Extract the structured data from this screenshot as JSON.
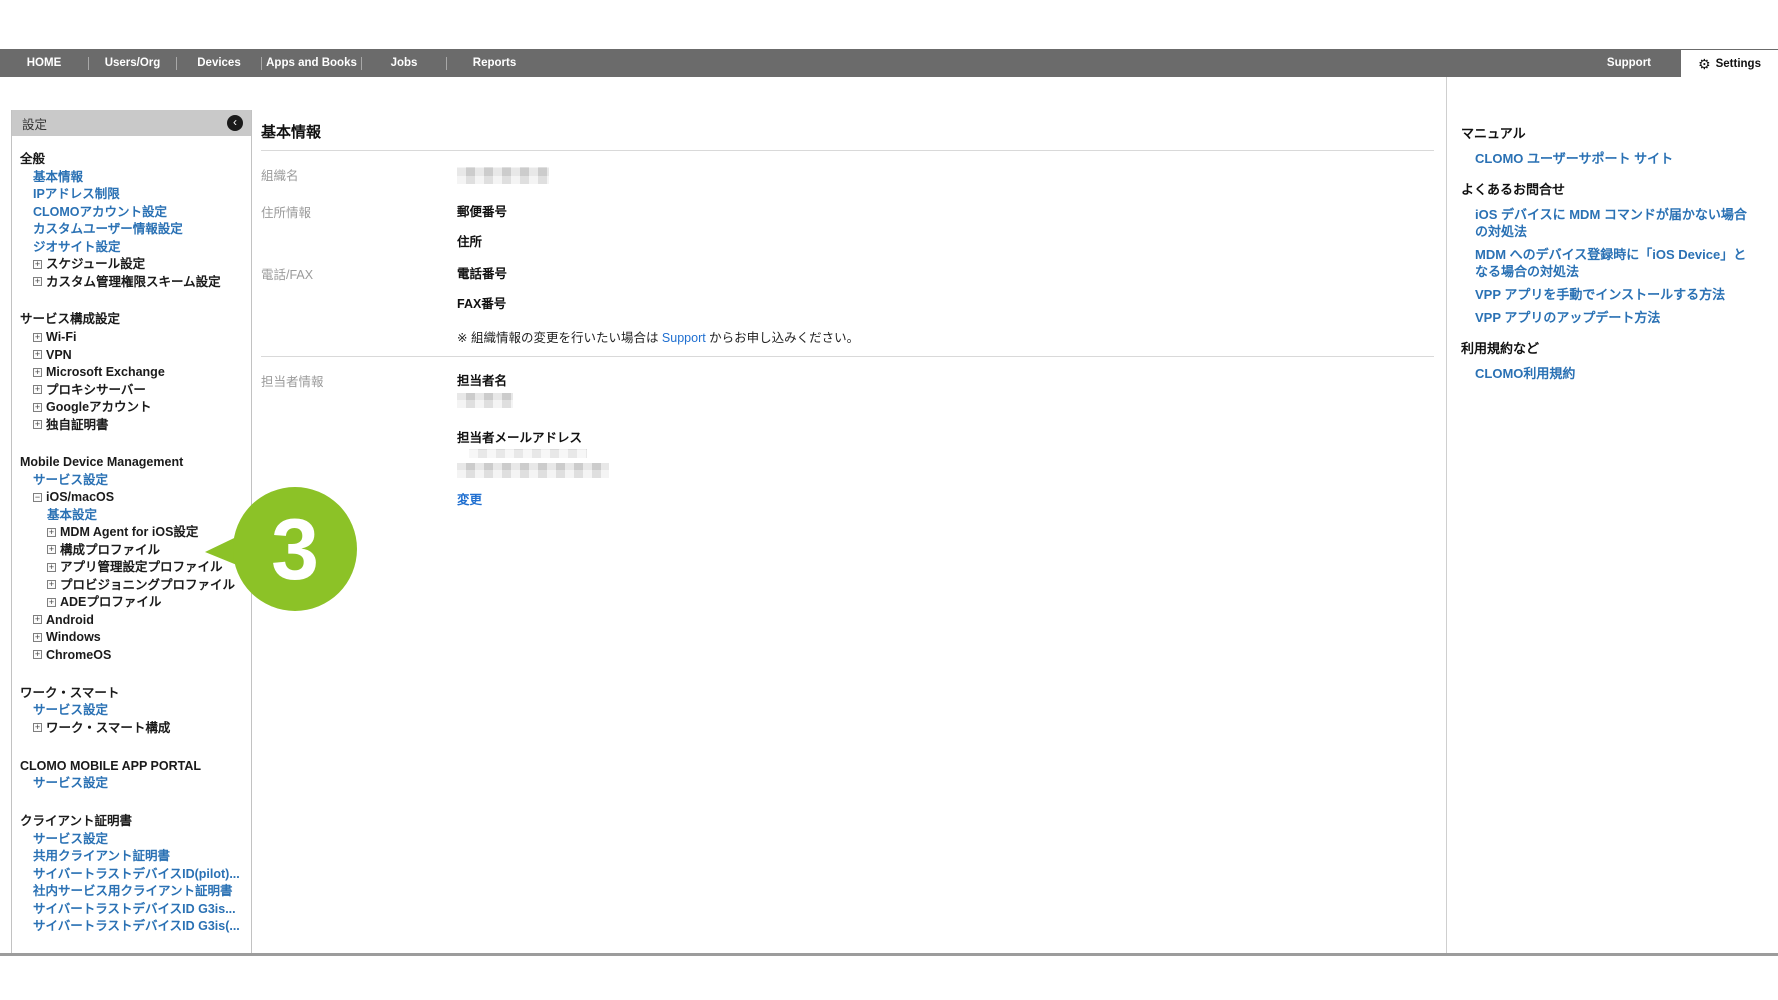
{
  "nav": {
    "items": [
      "HOME",
      "Users/Org",
      "Devices",
      "Apps and Books",
      "Jobs",
      "Reports"
    ],
    "support_label": "Support",
    "settings_label": "Settings",
    "settings_icon": "gear-icon"
  },
  "sidebar": {
    "header": "設定",
    "collapse_icon": "chevron-left-circle-icon",
    "sections": [
      {
        "title": "全般",
        "items": [
          {
            "label": "基本情報",
            "type": "link",
            "indent": 0
          },
          {
            "label": "IPアドレス制限",
            "type": "link",
            "indent": 0
          },
          {
            "label": "CLOMOアカウント設定",
            "type": "link",
            "indent": 0
          },
          {
            "label": "カスタムユーザー情報設定",
            "type": "link",
            "indent": 0
          },
          {
            "label": "ジオサイト設定",
            "type": "link",
            "indent": 0
          },
          {
            "label": "スケジュール設定",
            "type": "expand",
            "indent": 0
          },
          {
            "label": "カスタム管理権限スキーム設定",
            "type": "expand",
            "indent": 0
          }
        ]
      },
      {
        "title": "サービス構成設定",
        "items": [
          {
            "label": "Wi-Fi",
            "type": "expand",
            "indent": 0
          },
          {
            "label": "VPN",
            "type": "expand",
            "indent": 0
          },
          {
            "label": "Microsoft Exchange",
            "type": "expand",
            "indent": 0
          },
          {
            "label": "プロキシサーバー",
            "type": "expand",
            "indent": 0
          },
          {
            "label": "Googleアカウント",
            "type": "expand",
            "indent": 0
          },
          {
            "label": "独自証明書",
            "type": "expand",
            "indent": 0
          }
        ]
      },
      {
        "title": "Mobile Device Management",
        "items": [
          {
            "label": "サービス設定",
            "type": "link",
            "indent": 0
          },
          {
            "label": "iOS/macOS",
            "type": "collapse",
            "indent": 0
          },
          {
            "label": "基本設定",
            "type": "link",
            "indent": 1
          },
          {
            "label": "MDM Agent for iOS設定",
            "type": "expand",
            "indent": 1
          },
          {
            "label": "構成プロファイル",
            "type": "expand",
            "indent": 1
          },
          {
            "label": "アプリ管理設定プロファイル",
            "type": "expand",
            "indent": 1
          },
          {
            "label": "プロビジョニングプロファイル",
            "type": "expand",
            "indent": 1
          },
          {
            "label": "ADEプロファイル",
            "type": "expand",
            "indent": 1
          },
          {
            "label": "Android",
            "type": "expand",
            "indent": 0
          },
          {
            "label": "Windows",
            "type": "expand",
            "indent": 0
          },
          {
            "label": "ChromeOS",
            "type": "expand",
            "indent": 0
          }
        ]
      },
      {
        "title": "ワーク・スマート",
        "items": [
          {
            "label": "サービス設定",
            "type": "link",
            "indent": 0
          },
          {
            "label": "ワーク・スマート構成",
            "type": "expand",
            "indent": 0
          }
        ]
      },
      {
        "title": "CLOMO MOBILE APP PORTAL",
        "items": [
          {
            "label": "サービス設定",
            "type": "link",
            "indent": 0
          }
        ]
      },
      {
        "title": "クライアント証明書",
        "items": [
          {
            "label": "サービス設定",
            "type": "link",
            "indent": 0
          },
          {
            "label": "共用クライアント証明書",
            "type": "link",
            "indent": 0
          },
          {
            "label": "サイバートラストデバイスID(pilot)...",
            "type": "link",
            "indent": 0
          },
          {
            "label": "社内サービス用クライアント証明書",
            "type": "link",
            "indent": 0
          },
          {
            "label": "サイバートラストデバイスID G3is...",
            "type": "link",
            "indent": 0
          },
          {
            "label": "サイバートラストデバイスID G3is(...",
            "type": "link",
            "indent": 0
          }
        ]
      }
    ]
  },
  "main": {
    "title": "基本情報",
    "org_label": "組織名",
    "address_label": "住所情報",
    "postal_label": "郵便番号",
    "address_field_label": "住所",
    "phone_fax_label": "電話/FAX",
    "phone_field_label": "電話番号",
    "fax_field_label": "FAX番号",
    "note_prefix": "※ 組織情報の変更を行いたい場合は ",
    "note_link_label": "Support",
    "note_suffix": " からお申し込みください。",
    "contact_label": "担当者情報",
    "contact_name_label": "担当者名",
    "contact_email_label": "担当者メールアドレス",
    "change_link_label": "変更"
  },
  "help": {
    "manual_title": "マニュアル",
    "manual_links": [
      "CLOMO ユーザーサポート サイト"
    ],
    "faq_title": "よくあるお問合せ",
    "faq_links": [
      "iOS デバイスに MDM コマンドが届かない場合の対処法",
      "MDM へのデバイス登録時に「iOS Device」となる場合の対処法",
      "VPP アプリを手動でインストールする方法",
      "VPP アプリのアップデート方法"
    ],
    "terms_title": "利用規約など",
    "terms_links": [
      "CLOMO利用規約"
    ]
  },
  "annotation": {
    "step_label": "3"
  },
  "colors": {
    "nav_bg": "#6b6b6b",
    "sidebar_header_bg": "#c9c9c9",
    "link_blue": "#2a71b4",
    "action_blue": "#1f6fd0",
    "annotation_green": "#8cc227"
  }
}
